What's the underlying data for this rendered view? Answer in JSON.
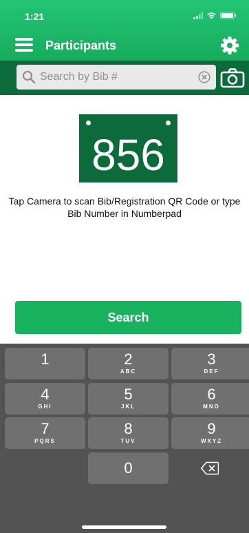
{
  "status": {
    "time": "1:21"
  },
  "nav": {
    "title": "Participants"
  },
  "search": {
    "placeholder": "Search by Bib #"
  },
  "bib": {
    "number": "856"
  },
  "instruction": "Tap Camera to scan Bib/Registration QR Code or type Bib Number in Numberpad",
  "search_button": {
    "label": "Search"
  },
  "keypad": {
    "keys": [
      {
        "digit": "1",
        "letters": ""
      },
      {
        "digit": "2",
        "letters": "ABC"
      },
      {
        "digit": "3",
        "letters": "DEF"
      },
      {
        "digit": "4",
        "letters": "GHI"
      },
      {
        "digit": "5",
        "letters": "JKL"
      },
      {
        "digit": "6",
        "letters": "MNO"
      },
      {
        "digit": "7",
        "letters": "PQRS"
      },
      {
        "digit": "8",
        "letters": "TUV"
      },
      {
        "digit": "9",
        "letters": "WXYZ"
      },
      {
        "digit": "0",
        "letters": ""
      }
    ]
  },
  "colors": {
    "brand_green": "#18ad5e",
    "dark_green": "#0d6b3b",
    "button_green": "#18b25f",
    "keypad_bg": "#535353",
    "key_bg": "#707070"
  }
}
